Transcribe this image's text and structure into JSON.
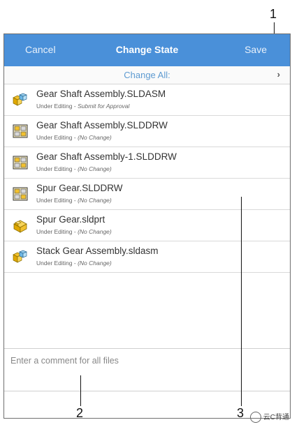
{
  "header": {
    "cancel_label": "Cancel",
    "title": "Change State",
    "save_label": "Save"
  },
  "change_all": {
    "label": "Change All:",
    "chevron": "›"
  },
  "files": [
    {
      "name": "Gear Shaft Assembly.SLDASM",
      "state": "Under Editing",
      "separator": " - ",
      "change": "Submit for Approval",
      "icon": "assembly-icon"
    },
    {
      "name": "Gear Shaft Assembly.SLDDRW",
      "state": "Under Editing",
      "separator": " - ",
      "change": "(No Change)",
      "icon": "drawing-icon"
    },
    {
      "name": "Gear Shaft Assembly-1.SLDDRW",
      "state": "Under Editing",
      "separator": " - ",
      "change": "(No Change)",
      "icon": "drawing-icon"
    },
    {
      "name": "Spur Gear.SLDDRW",
      "state": "Under Editing",
      "separator": " - ",
      "change": "(No Change)",
      "icon": "drawing-icon"
    },
    {
      "name": "Spur Gear.sldprt",
      "state": "Under Editing",
      "separator": " - ",
      "change": "(No Change)",
      "icon": "part-icon"
    },
    {
      "name": "Stack Gear Assembly.sldasm",
      "state": "Under Editing",
      "separator": " - ",
      "change": "(No Change)",
      "icon": "assembly-icon"
    }
  ],
  "comment": {
    "placeholder": "Enter a comment for all files"
  },
  "callouts": {
    "one": "1",
    "two": "2",
    "three": "3"
  },
  "watermark": {
    "text": "云C背通"
  },
  "colors": {
    "header_bg": "#4a90d9",
    "link_blue": "#5e9bd1"
  }
}
